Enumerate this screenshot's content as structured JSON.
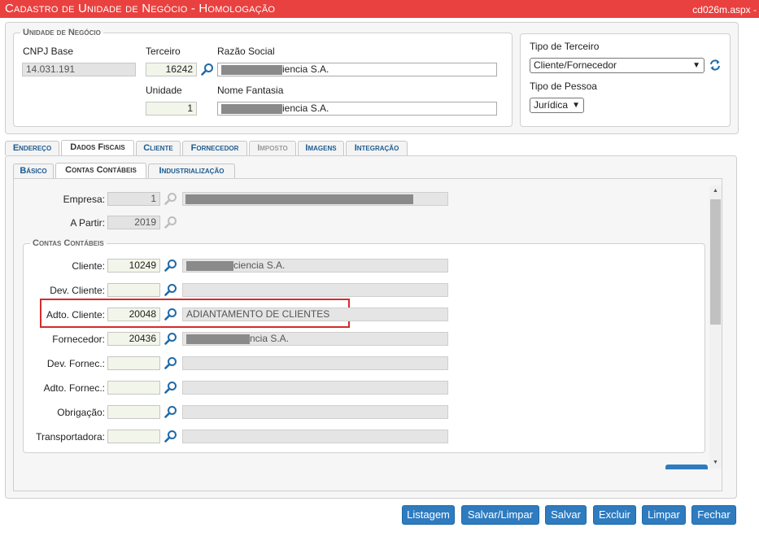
{
  "header": {
    "title": "Cadastro de Unidade de Negócio  - Homologação",
    "page": "cd026m.aspx -"
  },
  "unidade": {
    "legend": "Unidade de Negócio",
    "cnpj_label": "CNPJ Base",
    "cnpj_value": "14.031.191",
    "terceiro_label": "Terceiro",
    "terceiro_value": "16242",
    "razao_label": "Razão Social",
    "razao_value": "iencia S.A.",
    "unidade_label": "Unidade",
    "unidade_value": "1",
    "fantasia_label": "Nome Fantasia",
    "fantasia_value": "iencia S.A."
  },
  "tipo": {
    "terceiro_label": "Tipo de Terceiro",
    "terceiro_value": "Cliente/Fornecedor",
    "pessoa_label": "Tipo de Pessoa",
    "pessoa_value": "Jurídica"
  },
  "tabs": [
    "Endereço",
    "Dados Fiscais",
    "Cliente",
    "Fornecedor",
    "Imposto",
    "Imagens",
    "Integração"
  ],
  "subtabs": [
    "Básico",
    "Contas Contábeis",
    "Industrialização"
  ],
  "fiscal": {
    "empresa_label": "Empresa:",
    "empresa_value": "1",
    "apartir_label": "A Partir:",
    "apartir_value": "2019",
    "contas_legend": "Contas Contábeis",
    "contas": [
      {
        "label": "Cliente:",
        "code": "10249",
        "desc": "ciencia S.A."
      },
      {
        "label": "Dev. Cliente:",
        "code": "",
        "desc": ""
      },
      {
        "label": "Adto. Cliente:",
        "code": "20048",
        "desc": "ADIANTAMENTO DE CLIENTES"
      },
      {
        "label": "Fornecedor:",
        "code": "20436",
        "desc": "ncia S.A."
      },
      {
        "label": "Dev. Fornec.:",
        "code": "",
        "desc": ""
      },
      {
        "label": "Adto. Fornec.:",
        "code": "",
        "desc": ""
      },
      {
        "label": "Obrigação:",
        "code": "",
        "desc": ""
      },
      {
        "label": "Transportadora:",
        "code": "",
        "desc": ""
      }
    ]
  },
  "buttons": {
    "listagem": "Listagem",
    "salvar_limpar": "Salvar/Limpar",
    "salvar": "Salvar",
    "excluir": "Excluir",
    "limpar": "Limpar",
    "fechar": "Fechar"
  },
  "colors": {
    "titlebar": "#e8413f",
    "button": "#2e7bc0",
    "highlight": "#d62b2b"
  }
}
